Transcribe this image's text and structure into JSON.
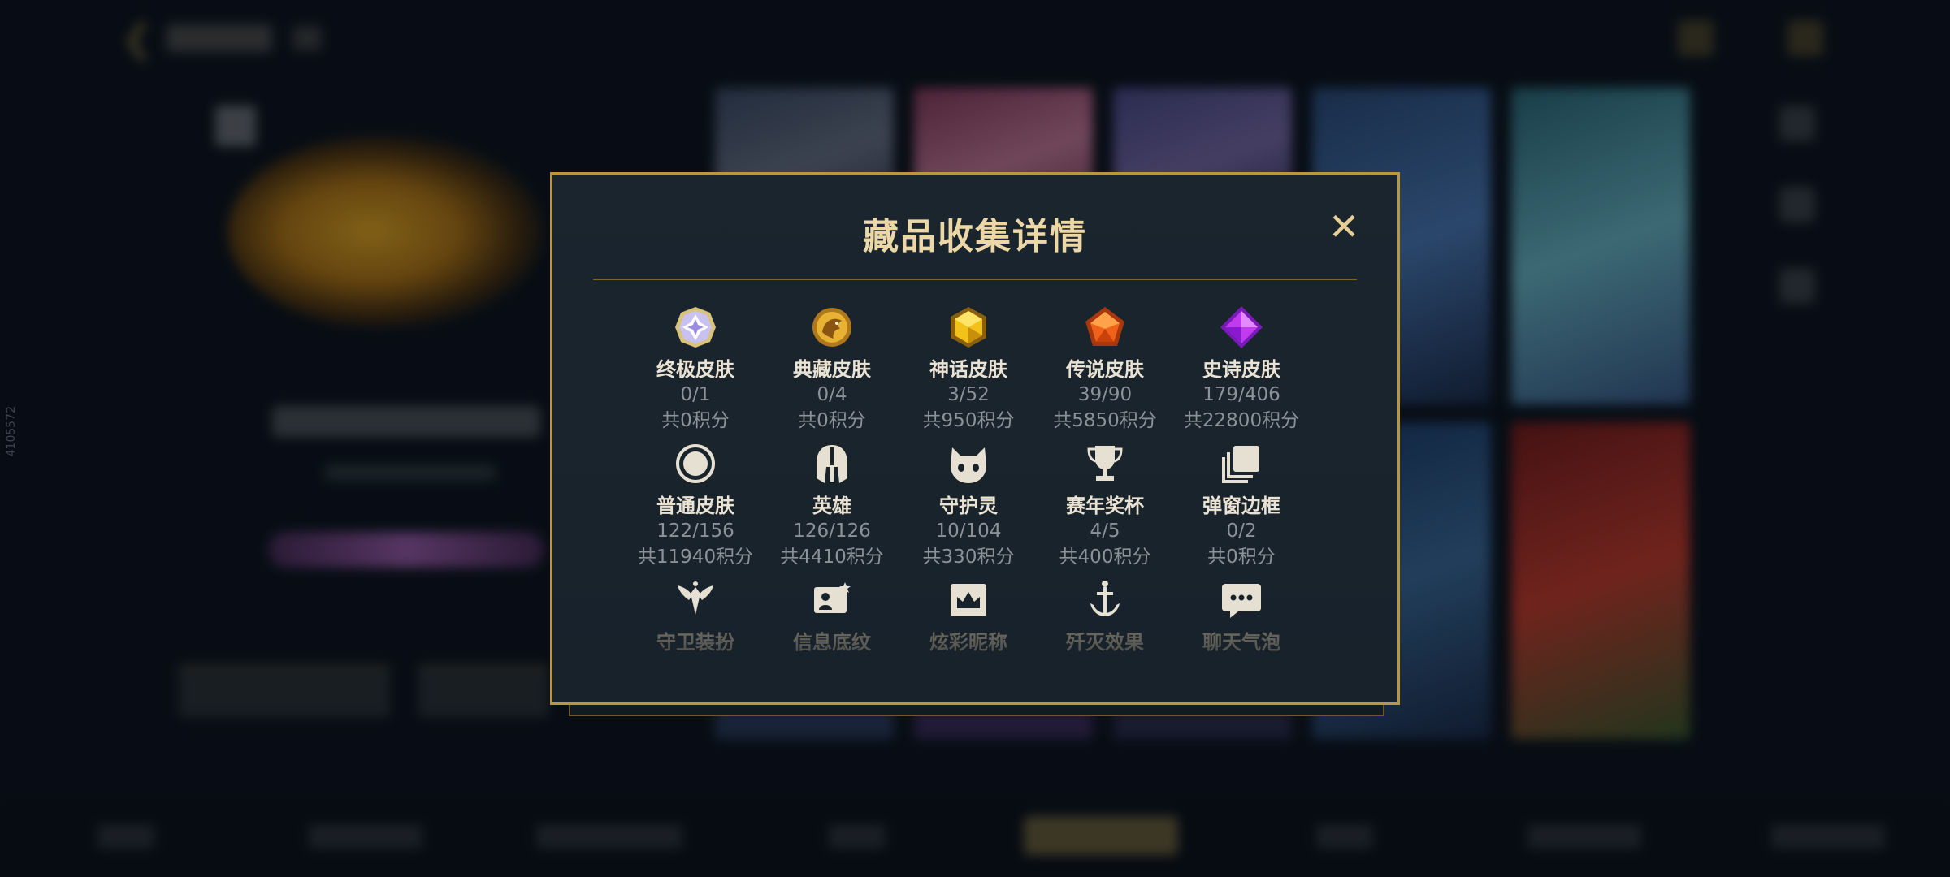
{
  "modal": {
    "title": "藏品收集详情",
    "close_label": "✕"
  },
  "side_text": "4105572",
  "colors": {
    "modal_border": "#b8973f",
    "title": "#ecd8a6",
    "label": "#eae3d3",
    "subtext": "#8b9299"
  },
  "collection_items": [
    {
      "label": "终极皮肤",
      "count": "0/1",
      "points": "共0积分",
      "icon": "ultimate-skin-icon"
    },
    {
      "label": "典藏皮肤",
      "count": "0/4",
      "points": "共0积分",
      "icon": "collection-skin-icon"
    },
    {
      "label": "神话皮肤",
      "count": "3/52",
      "points": "共950积分",
      "icon": "mythic-skin-icon"
    },
    {
      "label": "传说皮肤",
      "count": "39/90",
      "points": "共5850积分",
      "icon": "legendary-skin-icon"
    },
    {
      "label": "史诗皮肤",
      "count": "179/406",
      "points": "共22800积分",
      "icon": "epic-skin-icon"
    },
    {
      "label": "普通皮肤",
      "count": "122/156",
      "points": "共11940积分",
      "icon": "normal-skin-icon"
    },
    {
      "label": "英雄",
      "count": "126/126",
      "points": "共4410积分",
      "icon": "hero-helmet-icon"
    },
    {
      "label": "守护灵",
      "count": "10/104",
      "points": "共330积分",
      "icon": "guardian-spirit-icon"
    },
    {
      "label": "赛年奖杯",
      "count": "4/5",
      "points": "共400积分",
      "icon": "trophy-icon"
    },
    {
      "label": "弹窗边框",
      "count": "0/2",
      "points": "共0积分",
      "icon": "popup-frame-icon"
    },
    {
      "label": "守卫装扮",
      "icon": "ward-skin-icon"
    },
    {
      "label": "信息底纹",
      "icon": "info-background-icon"
    },
    {
      "label": "炫彩昵称",
      "icon": "colorful-nickname-icon"
    },
    {
      "label": "歼灭效果",
      "icon": "annihilation-effect-icon"
    },
    {
      "label": "聊天气泡",
      "icon": "chat-bubble-icon"
    }
  ]
}
